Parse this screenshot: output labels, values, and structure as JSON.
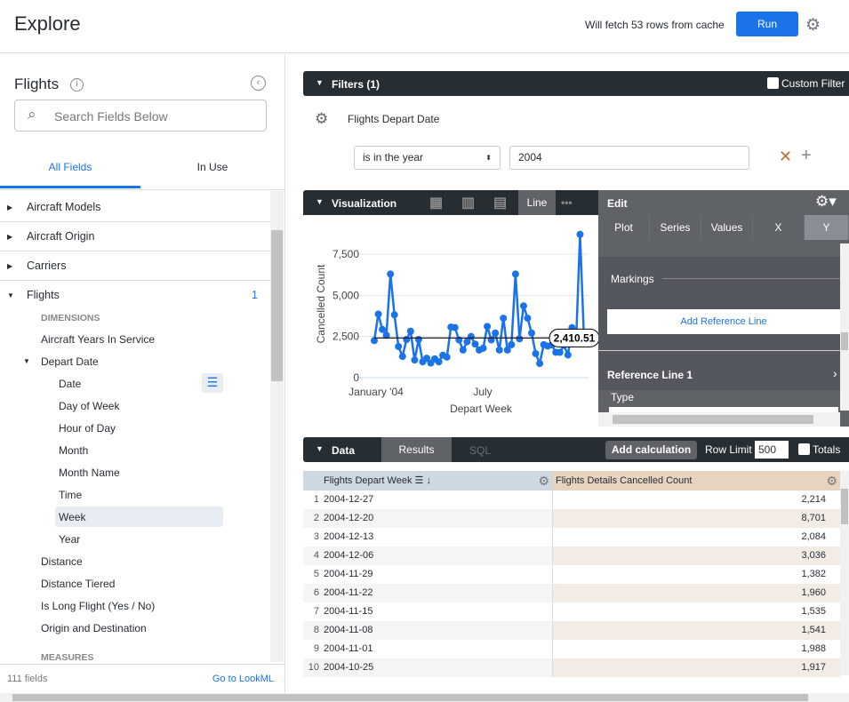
{
  "header": {
    "title": "Explore",
    "cache_text": "Will fetch 53 rows from cache",
    "run_label": "Run"
  },
  "sidebar": {
    "model": "Flights",
    "search_placeholder": "Search Fields Below",
    "tabs": [
      "All Fields",
      "In Use"
    ],
    "views": [
      {
        "label": "Aircraft Models"
      },
      {
        "label": "Aircraft Origin"
      },
      {
        "label": "Carriers"
      },
      {
        "label": "Flights",
        "count": "1"
      }
    ],
    "dimensions_label": "DIMENSIONS",
    "fields": [
      "Aircraft Years In Service",
      "Depart Date"
    ],
    "depart_date_fields": [
      "Date",
      "Day of Week",
      "Hour of Day",
      "Month",
      "Month Name",
      "Time",
      "Week",
      "Year"
    ],
    "more_fields": [
      "Distance",
      "Distance Tiered",
      "Is Long Flight (Yes / No)",
      "Origin and Destination"
    ],
    "measures_label": "MEASURES",
    "footer_count": "111 fields",
    "footer_link": "Go to LookML"
  },
  "filters": {
    "title": "Filters (1)",
    "custom_filter": "Custom Filter",
    "field_view": "Flights",
    "field_name": "Depart Date",
    "operator": "is in the year",
    "value": "2004"
  },
  "viz": {
    "title": "Visualization",
    "active_type": "Line",
    "edit_label": "Edit",
    "edit_tabs": [
      "Plot",
      "Series",
      "Values",
      "X",
      "Y"
    ],
    "markings": "Markings",
    "add_ref": "Add Reference Line",
    "ref_line": "Reference Line 1",
    "type_label": "Type"
  },
  "chart_data": {
    "type": "line",
    "xlabel": "Depart Week",
    "ylabel": "Cancelled Count",
    "x_ticks": [
      "January '04",
      "July"
    ],
    "y_ticks": [
      "0",
      "2,500",
      "5,000",
      "7,500"
    ],
    "ylim": [
      0,
      9000
    ],
    "color": "#1a73e8",
    "reference_line": {
      "value": 2410.51,
      "label": "2,410.51"
    },
    "values": [
      2250,
      3860,
      2930,
      2570,
      6290,
      3820,
      1890,
      1290,
      2320,
      2820,
      1070,
      2320,
      960,
      1180,
      890,
      1140,
      960,
      1360,
      1250,
      3070,
      3040,
      2290,
      1680,
      2180,
      2500,
      2040,
      1680,
      1790,
      3110,
      2290,
      2710,
      1680,
      3610,
      1680,
      2000,
      6290,
      2360,
      4360,
      3610,
      2710,
      1460,
      860,
      2000,
      1917,
      1988,
      1541,
      1535,
      1960,
      1382,
      3036,
      2084,
      8701,
      2214
    ]
  },
  "data": {
    "title": "Data",
    "tabs": [
      "Results",
      "SQL"
    ],
    "add_calc": "Add calculation",
    "row_limit_label": "Row Limit",
    "row_limit": "500",
    "totals": "Totals",
    "col1_view": "Flights",
    "col1_name": "Depart Week",
    "col2_view": "Flights Details",
    "col2_name": "Cancelled Count",
    "rows": [
      {
        "n": "1",
        "d": "2004-12-27",
        "v": "2,214"
      },
      {
        "n": "2",
        "d": "2004-12-20",
        "v": "8,701"
      },
      {
        "n": "3",
        "d": "2004-12-13",
        "v": "2,084"
      },
      {
        "n": "4",
        "d": "2004-12-06",
        "v": "3,036"
      },
      {
        "n": "5",
        "d": "2004-11-29",
        "v": "1,382"
      },
      {
        "n": "6",
        "d": "2004-11-22",
        "v": "1,960"
      },
      {
        "n": "7",
        "d": "2004-11-15",
        "v": "1,535"
      },
      {
        "n": "8",
        "d": "2004-11-08",
        "v": "1,541"
      },
      {
        "n": "9",
        "d": "2004-11-01",
        "v": "1,988"
      },
      {
        "n": "10",
        "d": "2004-10-25",
        "v": "1,917"
      }
    ]
  }
}
